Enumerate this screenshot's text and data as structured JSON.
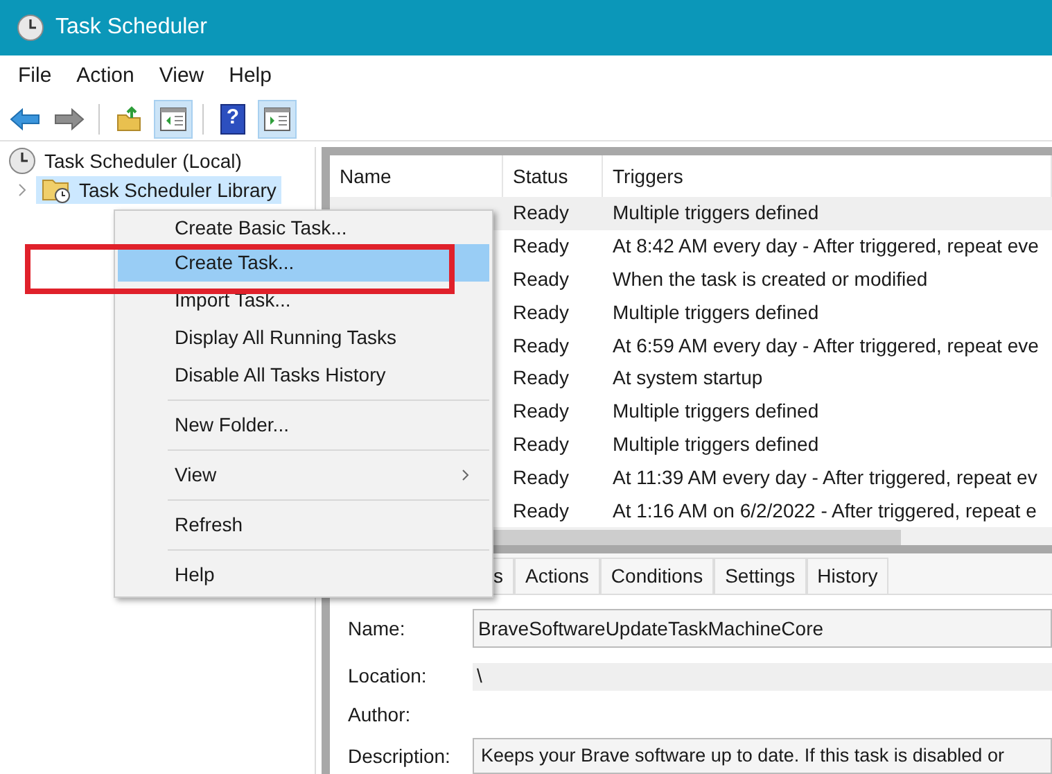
{
  "window": {
    "title": "Task Scheduler"
  },
  "menu_bar": [
    "File",
    "Action",
    "View",
    "Help"
  ],
  "toolbar": [
    {
      "kind": "back",
      "pressed": false
    },
    {
      "kind": "forward",
      "pressed": false
    },
    {
      "kind": "separator"
    },
    {
      "kind": "up-folder",
      "pressed": false
    },
    {
      "kind": "pane-left",
      "pressed": true
    },
    {
      "kind": "separator"
    },
    {
      "kind": "help",
      "pressed": false,
      "glyph": "?"
    },
    {
      "kind": "pane-right",
      "pressed": true
    }
  ],
  "tree": [
    {
      "label": "Task Scheduler (Local)",
      "selected": false,
      "children": [
        {
          "label": "Task Scheduler Library",
          "selected": true,
          "expanded": false
        }
      ]
    }
  ],
  "table": {
    "columns": [
      "Name",
      "Status",
      "Triggers"
    ],
    "rows": [
      {
        "status": "Ready",
        "triggers": "Multiple triggers defined",
        "selected": true
      },
      {
        "status": "Ready",
        "triggers": "At 8:42 AM every day - After triggered, repeat eve",
        "selected": false
      },
      {
        "status": "Ready",
        "triggers": "When the task is created or modified",
        "selected": false
      },
      {
        "status": "Ready",
        "triggers": "Multiple triggers defined",
        "selected": false
      },
      {
        "status": "Ready",
        "triggers": "At 6:59 AM every day - After triggered, repeat eve",
        "selected": false
      },
      {
        "status": "Ready",
        "triggers": "At system startup",
        "selected": false
      },
      {
        "status": "Ready",
        "triggers": "Multiple triggers defined",
        "selected": false
      },
      {
        "status": "Ready",
        "triggers": "Multiple triggers defined",
        "selected": false
      },
      {
        "status": "Ready",
        "triggers": "At 11:39 AM every day - After triggered, repeat ev",
        "selected": false
      },
      {
        "status": "Ready",
        "triggers": "At 1:16 AM on 6/2/2022 - After triggered, repeat e",
        "selected": false
      }
    ]
  },
  "detail_tabs": [
    "s",
    "Actions",
    "Conditions",
    "Settings",
    "History"
  ],
  "details": {
    "name_label": "Name:",
    "name_value": "BraveSoftwareUpdateTaskMachineCore",
    "location_label": "Location:",
    "location_value": "\\",
    "author_label": "Author:",
    "description_label": "Description:",
    "description_value": "Keeps your Brave software up to date. If this task is disabled or"
  },
  "context_menu": [
    {
      "kind": "item",
      "label": "Create Basic Task...",
      "selected": false,
      "submenu": false
    },
    {
      "kind": "item",
      "label": "Create Task...",
      "selected": true,
      "submenu": false
    },
    {
      "kind": "item",
      "label": "Import Task...",
      "selected": false,
      "submenu": false
    },
    {
      "kind": "item",
      "label": "Display All Running Tasks",
      "selected": false,
      "submenu": false
    },
    {
      "kind": "item",
      "label": "Disable All Tasks History",
      "selected": false,
      "submenu": false
    },
    {
      "kind": "separator"
    },
    {
      "kind": "item",
      "label": "New Folder...",
      "selected": false,
      "submenu": false
    },
    {
      "kind": "separator"
    },
    {
      "kind": "item",
      "label": "View",
      "selected": false,
      "submenu": true
    },
    {
      "kind": "separator"
    },
    {
      "kind": "item",
      "label": "Refresh",
      "selected": false,
      "submenu": false
    },
    {
      "kind": "separator"
    },
    {
      "kind": "item",
      "label": "Help",
      "selected": false,
      "submenu": false
    }
  ]
}
